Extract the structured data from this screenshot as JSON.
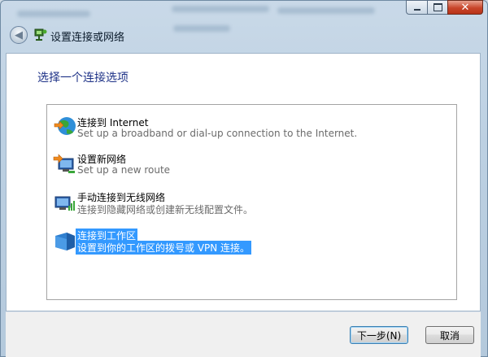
{
  "window": {
    "title": "设置连接或网络",
    "caption": {
      "close_symbol": "✕"
    }
  },
  "main": {
    "instruction": "选择一个连接选项",
    "options": [
      {
        "title": "连接到 Internet",
        "description": "Set up a broadband or dial-up connection to the Internet.",
        "icon": "globe-icon"
      },
      {
        "title": "设置新网络",
        "description": "Set up a new route",
        "icon": "new-network-icon"
      },
      {
        "title": "手动连接到无线网络",
        "description": "连接到隐藏网络或创建新无线配置文件。",
        "icon": "wireless-icon"
      },
      {
        "title": "连接到工作区",
        "description": "设置到你的工作区的拨号或 VPN 连接。",
        "icon": "workplace-icon",
        "selected": true
      }
    ]
  },
  "footer": {
    "next_label": "下一步(N)",
    "cancel_label": "取消"
  },
  "colors": {
    "selection": "#3399ff",
    "instruction": "#1e3287",
    "close_button": "#c8452a"
  }
}
